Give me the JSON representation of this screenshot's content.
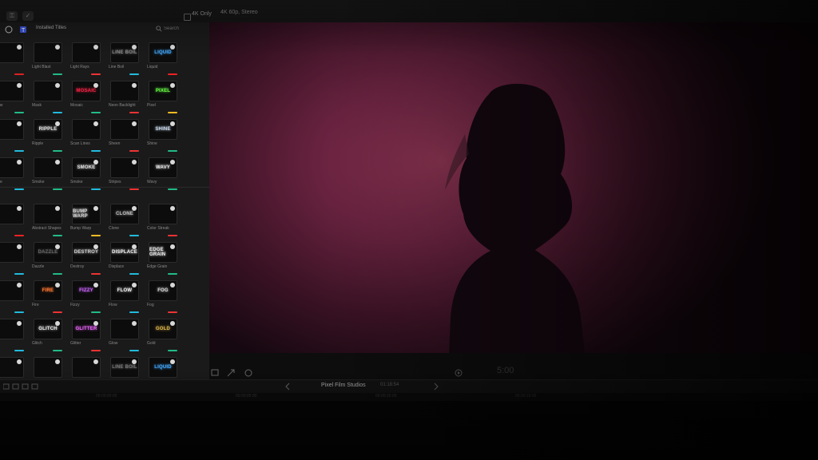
{
  "toolbar": {
    "format_checkbox_label": "4K Only",
    "format_info": "4K 60p, Stereo"
  },
  "browser": {
    "header": "Installed Titles",
    "search_placeholder": "Search",
    "group1": [
      {
        "thumb": "",
        "name": "",
        "color": "#d43",
        "bar": "#d22"
      },
      {
        "thumb": "",
        "name": "Light Blast",
        "color": "#e8a020",
        "bar": "#2b8"
      },
      {
        "thumb": "",
        "name": "Light Rays",
        "color": "#f2c040",
        "bar": "#e33"
      },
      {
        "thumb": "LINE BOIL",
        "name": "Line Boil",
        "color": "#888",
        "bar": "#2bd"
      },
      {
        "thumb": "LIQUID",
        "name": "Liquid",
        "color": "#4af",
        "bar": "#e22"
      },
      {
        "thumb": "",
        "name": "Glow",
        "color": "#ccc",
        "bar": "#2b8"
      },
      {
        "thumb": "",
        "name": "Mask",
        "color": "#aaa",
        "bar": "#2bd"
      },
      {
        "thumb": "MOSAIC",
        "name": "Mosaic",
        "color": "#e24",
        "bar": "#2b8"
      },
      {
        "thumb": "",
        "name": "Neon Backlight",
        "color": "#f59",
        "bar": "#e33"
      },
      {
        "thumb": "PIXEL",
        "name": "Pixel",
        "color": "#6f4",
        "bar": "#fb2"
      },
      {
        "thumb": "",
        "name": "",
        "color": "#4af",
        "bar": "#2bd"
      },
      {
        "thumb": "RIPPLE",
        "name": "Ripple",
        "color": "#ddd",
        "bar": "#2b8"
      },
      {
        "thumb": "",
        "name": "Scan Lines",
        "color": "#8cf",
        "bar": "#2bd"
      },
      {
        "thumb": "",
        "name": "Sheen",
        "color": "#7bf",
        "bar": "#e33"
      },
      {
        "thumb": "SHINE",
        "name": "Shine",
        "color": "#cde",
        "bar": "#2b8"
      },
      {
        "thumb": "",
        "name": "Slice",
        "color": "#ddd",
        "bar": "#2bd"
      },
      {
        "thumb": "",
        "name": "Smoke",
        "color": "#c44",
        "bar": "#2b8"
      },
      {
        "thumb": "SMOKE",
        "name": "Smoke",
        "color": "#ddd",
        "bar": "#2bd"
      },
      {
        "thumb": "",
        "name": "Stripes",
        "color": "#f80",
        "bar": "#e33"
      },
      {
        "thumb": "WAVY",
        "name": "Wavy",
        "color": "#eee",
        "bar": "#2b8"
      }
    ],
    "group2": [
      {
        "thumb": "",
        "name": "",
        "color": "#f5a",
        "bar": "#e22"
      },
      {
        "thumb": "",
        "name": "Abstract Shapes",
        "color": "#a6f",
        "bar": "#2b8"
      },
      {
        "thumb": "BUMP WARP",
        "name": "Bump Warp",
        "color": "#ddd",
        "bar": "#fb2"
      },
      {
        "thumb": "CLONE",
        "name": "Clone",
        "color": "#bbb",
        "bar": "#2bd"
      },
      {
        "thumb": "",
        "name": "Color Streak",
        "color": "#4cf",
        "bar": "#e33"
      },
      {
        "thumb": "",
        "name": "",
        "color": "#ccc",
        "bar": "#2bd"
      },
      {
        "thumb": "DAZZLE",
        "name": "Dazzle",
        "color": "#666",
        "bar": "#2b8"
      },
      {
        "thumb": "DESTROY",
        "name": "Destroy",
        "color": "#ccc",
        "bar": "#e33"
      },
      {
        "thumb": "DISPLACE",
        "name": "Displace",
        "color": "#eee",
        "bar": "#2bd"
      },
      {
        "thumb": "EDGE GRAIN",
        "name": "Edge Grain",
        "color": "#eee",
        "bar": "#2b8"
      },
      {
        "thumb": "",
        "name": "",
        "color": "#e44",
        "bar": "#2bd"
      },
      {
        "thumb": "FIRE",
        "name": "Fire",
        "color": "#f73",
        "bar": "#e33"
      },
      {
        "thumb": "FIZZY",
        "name": "Fizzy",
        "color": "#c6f",
        "bar": "#2b8"
      },
      {
        "thumb": "FLOW",
        "name": "Flow",
        "color": "#eee",
        "bar": "#2bd"
      },
      {
        "thumb": "FOG",
        "name": "Fog",
        "color": "#ddd",
        "bar": "#e33"
      },
      {
        "thumb": "",
        "name": "",
        "color": "#ccc",
        "bar": "#2bd"
      },
      {
        "thumb": "GLITCH",
        "name": "Glitch",
        "color": "#eee",
        "bar": "#2b8"
      },
      {
        "thumb": "GLITTER",
        "name": "Glitter",
        "color": "#e6f",
        "bar": "#e33"
      },
      {
        "thumb": "",
        "name": "Glow",
        "color": "#99f",
        "bar": "#2bd"
      },
      {
        "thumb": "GOLD",
        "name": "Gold",
        "color": "#d9b24a",
        "bar": "#2b8"
      },
      {
        "thumb": "",
        "name": "",
        "color": "#e44",
        "bar": "#e22"
      },
      {
        "thumb": "",
        "name": "",
        "color": "#d9b24a",
        "bar": "#2b8"
      },
      {
        "thumb": "",
        "name": "",
        "color": "#e8a020",
        "bar": "#fb2"
      },
      {
        "thumb": "LINE BOIL",
        "name": "",
        "color": "#777",
        "bar": "#2bd"
      },
      {
        "thumb": "LIQUID",
        "name": "",
        "color": "#4af",
        "bar": "#e22"
      }
    ]
  },
  "viewer": {
    "timecode": "5:00"
  },
  "timeline": {
    "project": "Pixel Film Studios",
    "duration": "01:18:54",
    "ruler": [
      "00:00:00:00",
      "00:00:05:00",
      "00:00:10:00",
      "00:00:15:00"
    ]
  }
}
